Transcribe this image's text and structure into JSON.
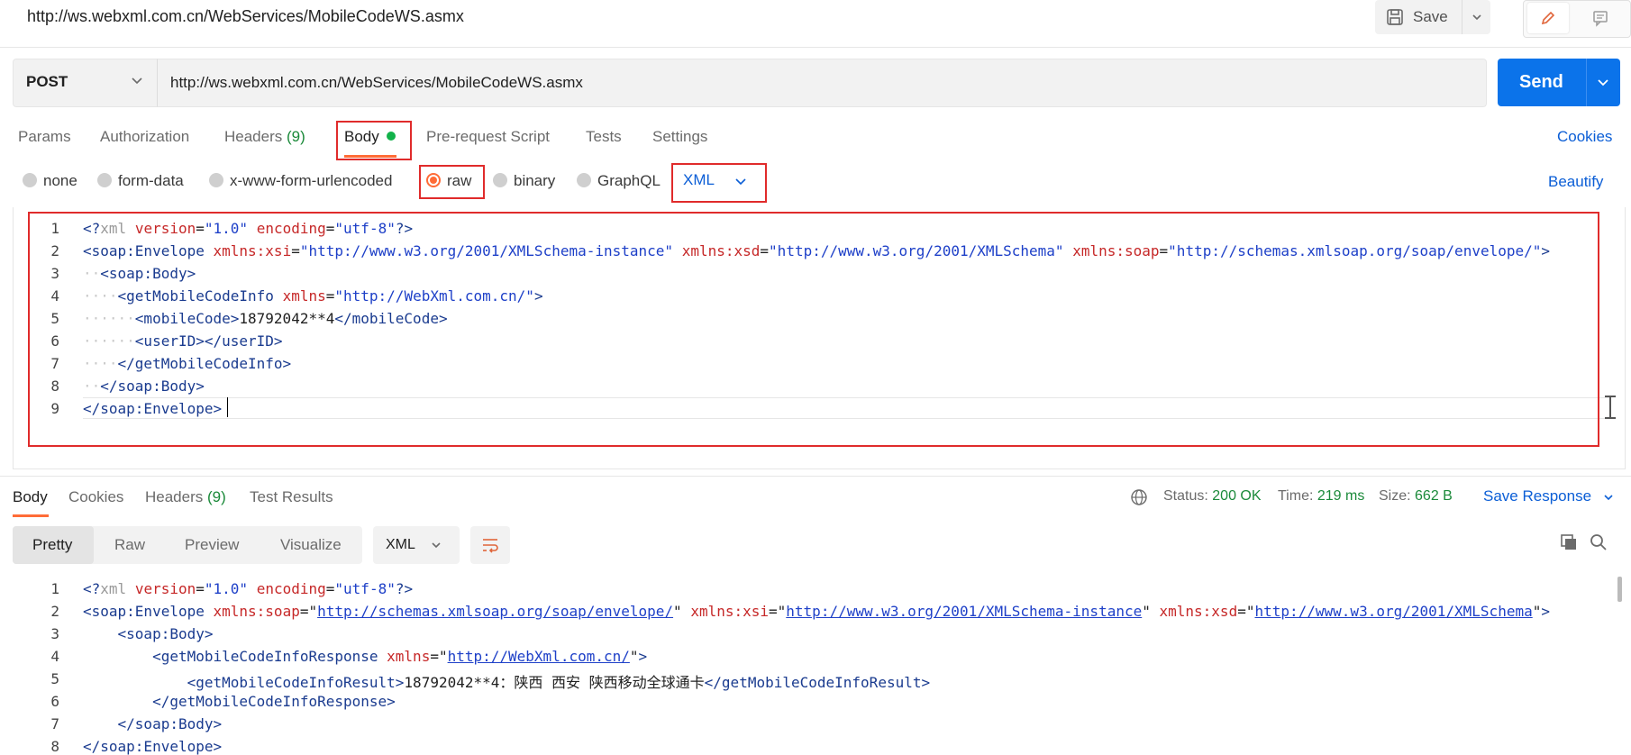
{
  "header": {
    "title": "http://ws.webxml.com.cn/WebServices/MobileCodeWS.asmx",
    "save_label": "Save"
  },
  "request": {
    "method": "POST",
    "url": "http://ws.webxml.com.cn/WebServices/MobileCodeWS.asmx",
    "send_label": "Send"
  },
  "tabs": {
    "params": "Params",
    "authorization": "Authorization",
    "headers": "Headers",
    "headers_count": "(9)",
    "body": "Body",
    "prerequest": "Pre-request Script",
    "tests": "Tests",
    "settings": "Settings",
    "cookies": "Cookies"
  },
  "body_types": {
    "none": "none",
    "form_data": "form-data",
    "urlencoded": "x-www-form-urlencoded",
    "raw": "raw",
    "binary": "binary",
    "graphql": "GraphQL",
    "selected": "raw",
    "language": "XML",
    "beautify": "Beautify"
  },
  "request_body": {
    "line_numbers": [
      "1",
      "2",
      "3",
      "4",
      "5",
      "6",
      "7",
      "8",
      "9"
    ],
    "l1": {
      "open": "<?",
      "xml": "xml",
      "version_attr": "version",
      "version_val": "\"1.0\"",
      "enc_attr": "encoding",
      "enc_val": "\"utf-8\"",
      "close": "?>"
    },
    "l2": {
      "tag": "<soap:Envelope",
      "a1": "xmlns:xsi",
      "v1": "\"http://www.w3.org/2001/XMLSchema-instance\"",
      "a2": "xmlns:xsd",
      "v2": "\"http://www.w3.org/2001/XMLSchema\"",
      "a3": "xmlns:soap",
      "v3": "\"http://schemas.xmlsoap.org/soap/envelope/\"",
      "end": ">"
    },
    "l3": "<soap:Body>",
    "l4": {
      "tag": "<getMobileCodeInfo",
      "attr": "xmlns",
      "val": "\"http://WebXml.com.cn/\"",
      "end": ">"
    },
    "l5": {
      "open": "<mobileCode>",
      "value": "18792042**4",
      "close": "</mobileCode>"
    },
    "l6": "<userID></userID>",
    "l7": "</getMobileCodeInfo>",
    "l8": "</soap:Body>",
    "l9": "</soap:Envelope>"
  },
  "response": {
    "tabs": {
      "body": "Body",
      "cookies": "Cookies",
      "headers": "Headers",
      "headers_count": "(9)",
      "test_results": "Test Results"
    },
    "status_label": "Status:",
    "status_value": "200 OK",
    "time_label": "Time:",
    "time_value": "219 ms",
    "size_label": "Size:",
    "size_value": "662 B",
    "save_response": "Save Response",
    "views": {
      "pretty": "Pretty",
      "raw": "Raw",
      "preview": "Preview",
      "visualize": "Visualize"
    },
    "language": "XML",
    "line_numbers": [
      "1",
      "2",
      "3",
      "4",
      "5",
      "6",
      "7",
      "8"
    ],
    "l1": {
      "open": "<?",
      "xml": "xml",
      "version_attr": "version",
      "version_val": "\"1.0\"",
      "enc_attr": "encoding",
      "enc_val": "\"utf-8\"",
      "close": "?>"
    },
    "l2": {
      "tag": "<soap:Envelope",
      "a1": "xmlns:soap",
      "v1": "http://schemas.xmlsoap.org/soap/envelope/",
      "a2": "xmlns:xsi",
      "v2": "http://www.w3.org/2001/XMLSchema-instance",
      "a3": "xmlns:xsd",
      "v3": "http://www.w3.org/2001/XMLSchema",
      "end": ">"
    },
    "l3": "<soap:Body>",
    "l4": {
      "tag": "<getMobileCodeInfoResponse",
      "attr": "xmlns",
      "val": "http://WebXml.com.cn/",
      "end": ">"
    },
    "l5": {
      "open": "<getMobileCodeInfoResult>",
      "value": "18792042**4：陕西 西安 陕西移动全球通卡",
      "close": "</getMobileCodeInfoResult>"
    },
    "l6": "</getMobileCodeInfoResponse>",
    "l7": "</soap:Body>",
    "l8": "</soap:Envelope>"
  },
  "colors": {
    "accent": "#ff6c37",
    "send": "#0b73ea",
    "link": "#0b5ed6",
    "success": "#1b8a3a",
    "highlight_box": "#e02b2b"
  }
}
